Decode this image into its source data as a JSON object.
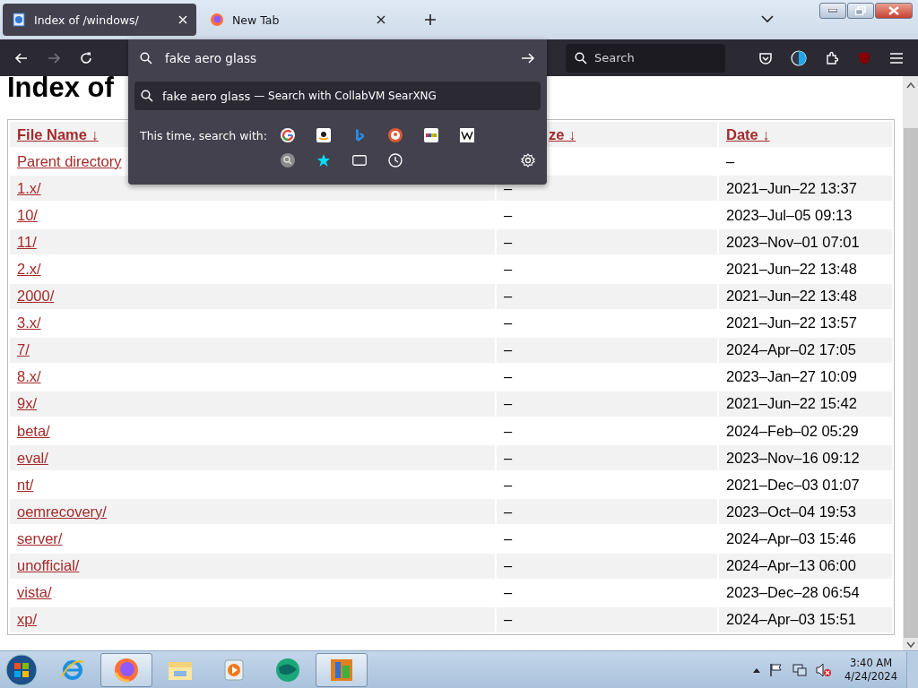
{
  "browser": {
    "tabs": [
      {
        "title": "Index of /windows/",
        "selected": true,
        "kind": "page"
      },
      {
        "title": "New Tab",
        "selected": false,
        "kind": "firefox"
      }
    ],
    "forward_disabled": true,
    "address_bar": {
      "value": "fake aero glass"
    },
    "search_field": {
      "placeholder": "Search"
    },
    "url_dropdown": {
      "suggestion": {
        "query": "fake aero glass",
        "action": "— Search with CollabVM SearXNG"
      },
      "one_offs_label": "This time, search with:",
      "engines": [
        {
          "kind": "google"
        },
        {
          "kind": "amazon"
        },
        {
          "kind": "bing"
        },
        {
          "kind": "duckduckgo"
        },
        {
          "kind": "ebay"
        },
        {
          "kind": "wikipedia"
        }
      ],
      "modes": [
        {
          "kind": "searx"
        },
        {
          "kind": "bookmarks"
        },
        {
          "kind": "tabs"
        },
        {
          "kind": "history"
        }
      ]
    }
  },
  "page": {
    "heading": "Index of",
    "columns": [
      "File Name ↓",
      "ze ↓",
      "Date ↓"
    ],
    "rows": [
      {
        "name": "Parent directory",
        "date": "–"
      },
      {
        "name": "1.x/",
        "size": "–",
        "date": "2021–Jun–22 13:37"
      },
      {
        "name": "10/",
        "size": "–",
        "date": "2023–Jul–05 09:13"
      },
      {
        "name": "11/",
        "size": "–",
        "date": "2023–Nov–01 07:01"
      },
      {
        "name": "2.x/",
        "size": "–",
        "date": "2021–Jun–22 13:48"
      },
      {
        "name": "2000/",
        "size": "–",
        "date": "2021–Jun–22 13:48"
      },
      {
        "name": "3.x/",
        "size": "–",
        "date": "2021–Jun–22 13:57"
      },
      {
        "name": "7/",
        "size": "–",
        "date": "2024–Apr–02 17:05"
      },
      {
        "name": "8.x/",
        "size": "–",
        "date": "2023–Jan–27 10:09"
      },
      {
        "name": "9x/",
        "size": "–",
        "date": "2021–Jun–22 15:42"
      },
      {
        "name": "beta/",
        "size": "–",
        "date": "2024–Feb–02 05:29"
      },
      {
        "name": "eval/",
        "size": "–",
        "date": "2023–Nov–16 09:12"
      },
      {
        "name": "nt/",
        "size": "–",
        "date": "2021–Dec–03 01:07"
      },
      {
        "name": "oemrecovery/",
        "size": "–",
        "date": "2023–Oct–04 19:53"
      },
      {
        "name": "server/",
        "size": "–",
        "date": "2024–Apr–03 15:46"
      },
      {
        "name": "unofficial/",
        "size": "–",
        "date": "2024–Apr–13 06:00"
      },
      {
        "name": "vista/",
        "size": "–",
        "date": "2023–Dec–28 06:54"
      },
      {
        "name": "xp/",
        "size": "–",
        "date": "2024–Apr–03 15:51"
      }
    ]
  },
  "taskbar": {
    "apps": [
      {
        "kind": "ie",
        "active": false
      },
      {
        "kind": "firefox",
        "active": true
      },
      {
        "kind": "explorer",
        "active": false
      },
      {
        "kind": "media",
        "active": false
      },
      {
        "kind": "globe",
        "active": false
      },
      {
        "kind": "paint",
        "active": true
      }
    ],
    "clock": {
      "time": "3:40 AM",
      "date": "4/24/2024"
    }
  }
}
